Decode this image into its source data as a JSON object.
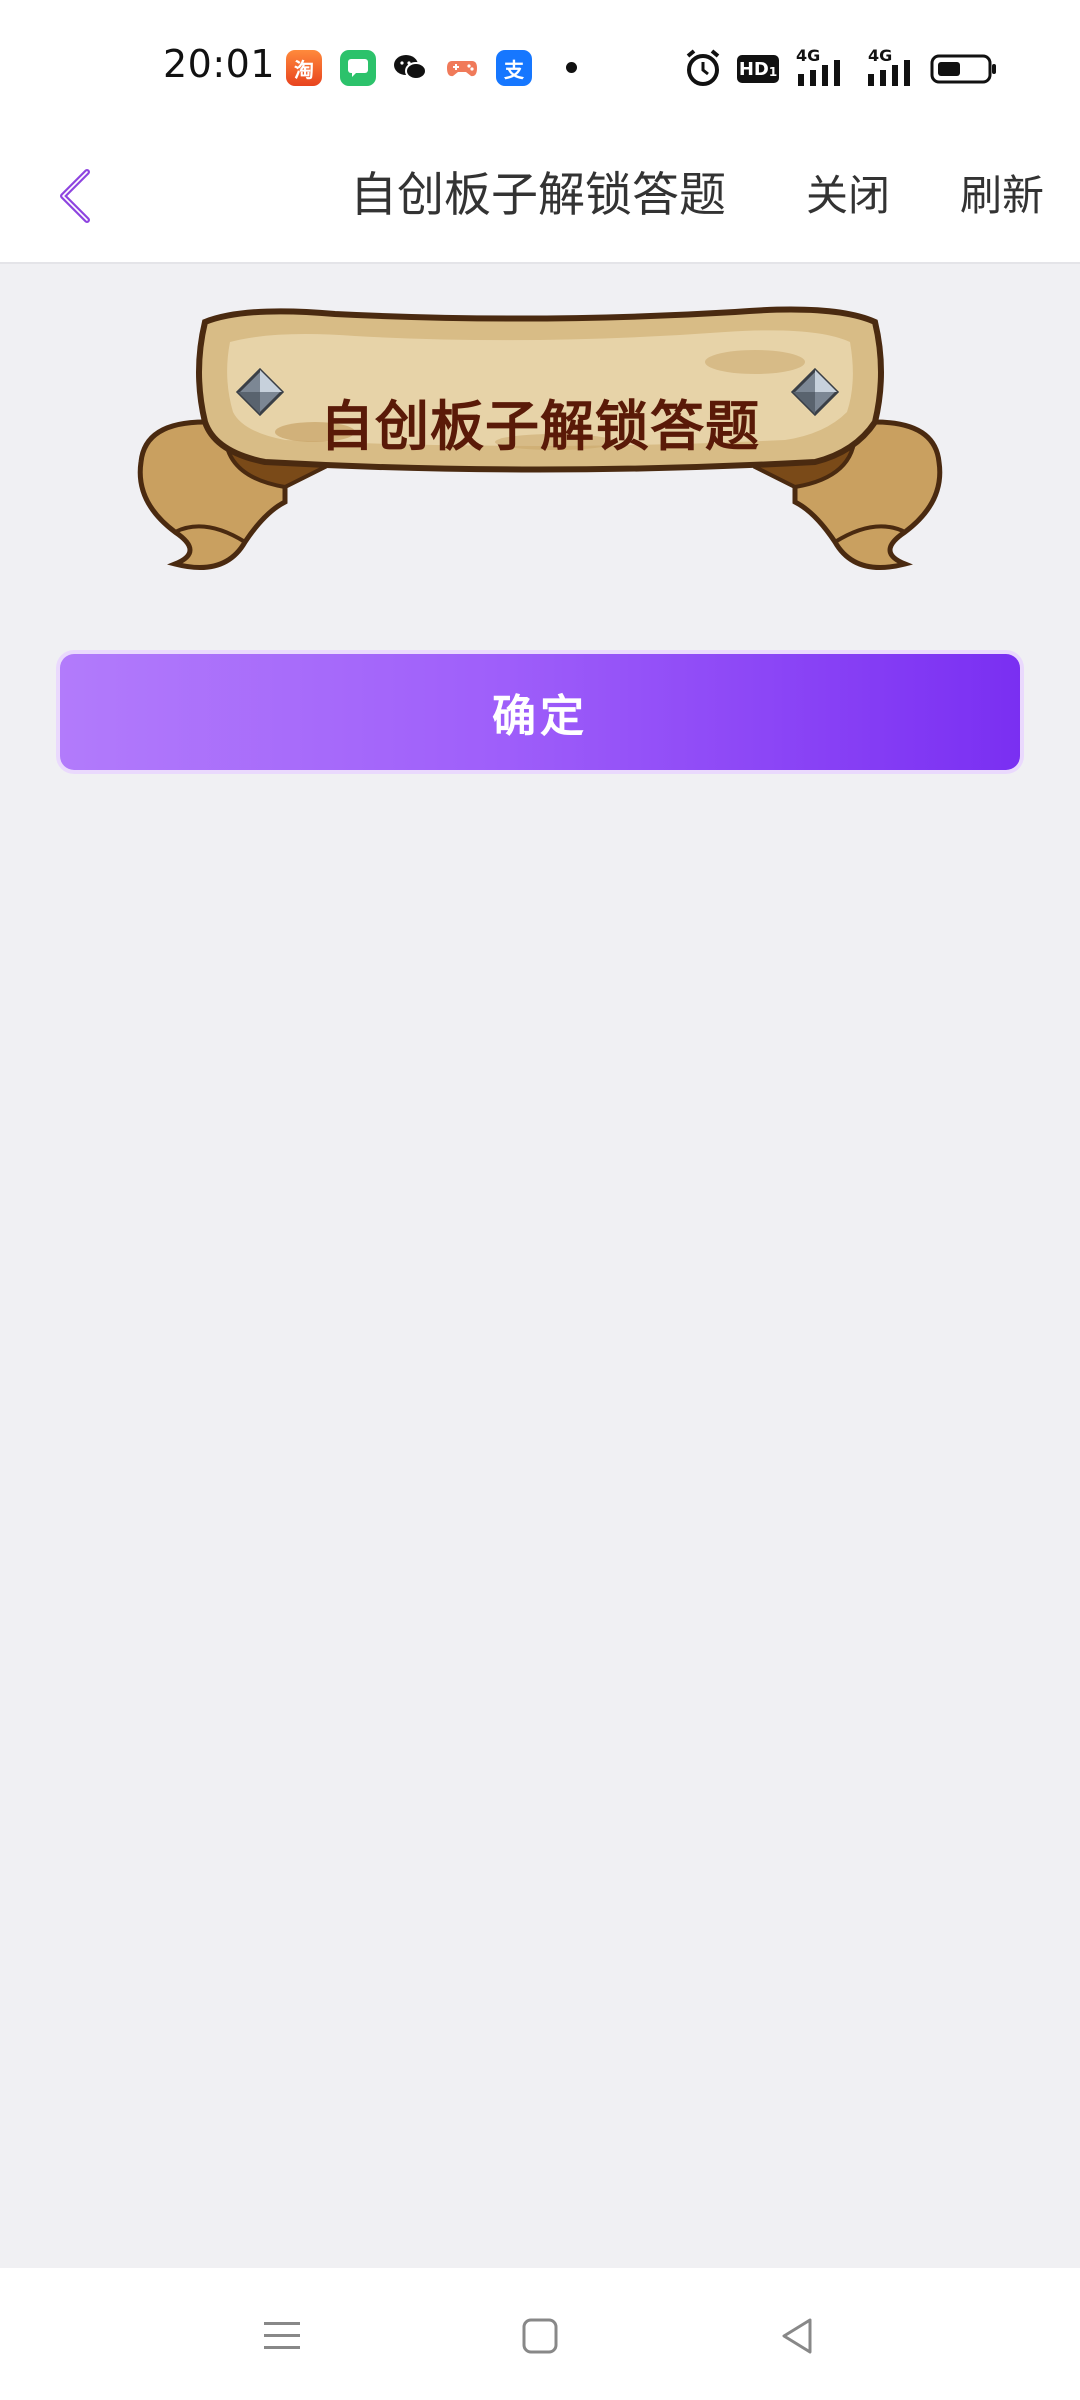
{
  "status_bar": {
    "time": "20:01",
    "notification_icons": [
      "taobao-icon",
      "chat-bubble-icon",
      "wechat-icon",
      "game-controller-icon",
      "alipay-icon"
    ],
    "taobao_glyph": "淘",
    "alipay_glyph": "支",
    "hd_label": "HD",
    "hd_sub": "1",
    "network_label_1": "4G",
    "network_label_2": "4G"
  },
  "nav": {
    "title": "自创板子解锁答题",
    "close_label": "关闭",
    "refresh_label": "刷新"
  },
  "banner": {
    "text": "自创板子解锁答题"
  },
  "confirm_button": {
    "label": "确定"
  },
  "colors": {
    "accent_purple": "#7a2ff2",
    "back_arrow": "#8e44e0",
    "banner_text": "#5a1a08",
    "page_background": "#f0f0f3"
  }
}
